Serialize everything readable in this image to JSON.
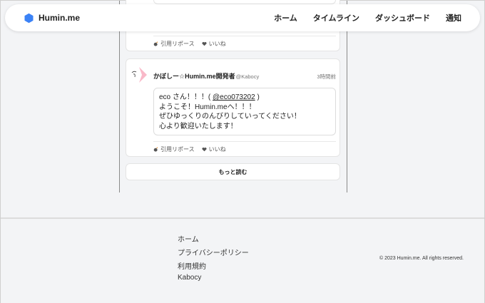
{
  "nav": {
    "brand": "Humin.me",
    "links": [
      "ホーム",
      "タイムライン",
      "ダッシュボード",
      "通知"
    ]
  },
  "posts": [
    {
      "actions": {
        "quote_repost": "引用リポース",
        "like": "いいね"
      }
    },
    {
      "author": "かぼしー☆Humin.me開発者",
      "handle": "@Kabocy",
      "time": "3時間前",
      "content": {
        "line1_prefix": "eco さん！！！(",
        "mention": "@eco073202",
        "line1_suffix": ")",
        "line2": "ようこそ！Humin.meへ！！！",
        "line3": "ぜひゆっくりのんびりしていってください！",
        "line4": "心より歓迎いたします！"
      },
      "actions": {
        "quote_repost": "引用リポース",
        "like": "いいね"
      }
    }
  ],
  "read_more": "もっと読む",
  "footer": {
    "links": [
      "ホーム",
      "プライバシーポリシー",
      "利用規約",
      "Kabocy"
    ],
    "copyright": "© 2023 Humin.me. All rights reserved."
  },
  "colors": {
    "brand": "#3b82f6",
    "background": "#f3f4f6",
    "card": "#ffffff"
  },
  "icons": {
    "brand": "hexagon-logo-icon",
    "quote_repost": "repost-bomb-icon",
    "like": "heart-icon"
  }
}
